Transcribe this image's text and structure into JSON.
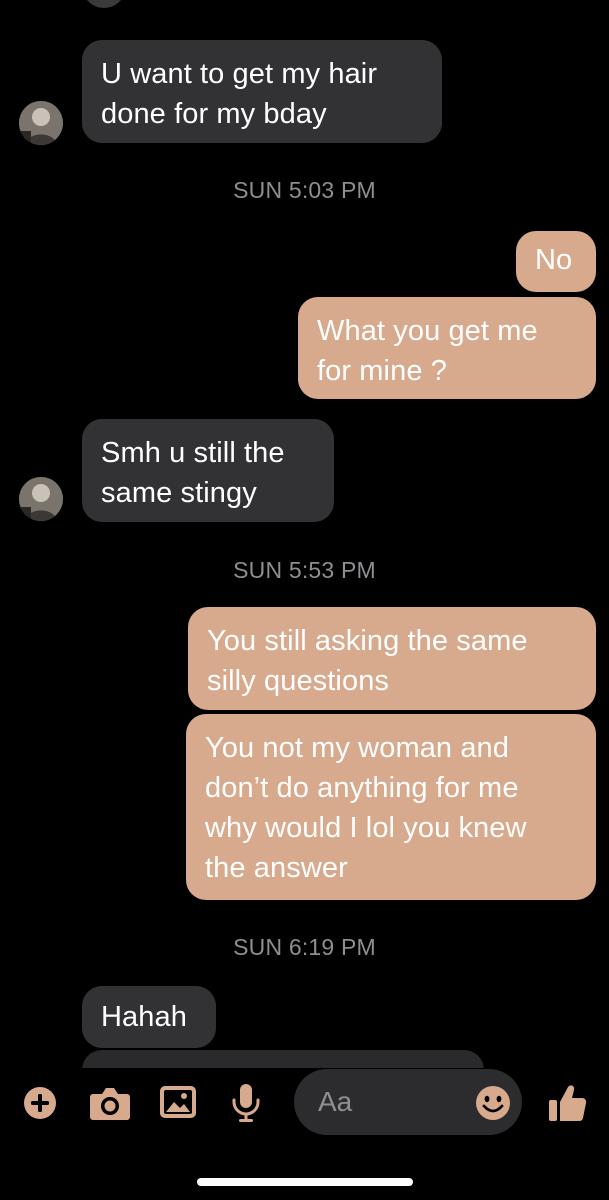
{
  "messages": [
    {
      "id": "m1",
      "direction": "in",
      "lines": [
        "U want to get my hair",
        "done for my bday"
      ]
    },
    {
      "id": "m2",
      "direction": "out",
      "lines": [
        "No"
      ]
    },
    {
      "id": "m3",
      "direction": "out",
      "lines": [
        "What you get me",
        "for mine ?"
      ]
    },
    {
      "id": "m4",
      "direction": "in",
      "lines": [
        "Smh u still the",
        "same stingy"
      ]
    },
    {
      "id": "m5",
      "direction": "out",
      "lines": [
        "You still asking the same",
        "silly questions"
      ]
    },
    {
      "id": "m6",
      "direction": "out",
      "lines": [
        "You not my woman and",
        "don’t do anything for me",
        "why would I lol you knew",
        "the answer"
      ]
    },
    {
      "id": "m7",
      "direction": "in",
      "lines": [
        "Hahah"
      ]
    }
  ],
  "timestamps": {
    "t1": "SUN 5:03 PM",
    "t2": "SUN 5:53 PM",
    "t3": "SUN 6:19 PM"
  },
  "composer": {
    "placeholder": "Aa",
    "icons": [
      "plus-icon",
      "camera-icon",
      "image-icon",
      "microphone-icon",
      "emoji-icon",
      "thumbs-up-icon"
    ]
  },
  "colors": {
    "background": "#000000",
    "incoming_bubble": "#323235",
    "outgoing_bubble": "#d7a98d",
    "accent": "#d7a98d",
    "timestamp": "#8e8e93"
  }
}
